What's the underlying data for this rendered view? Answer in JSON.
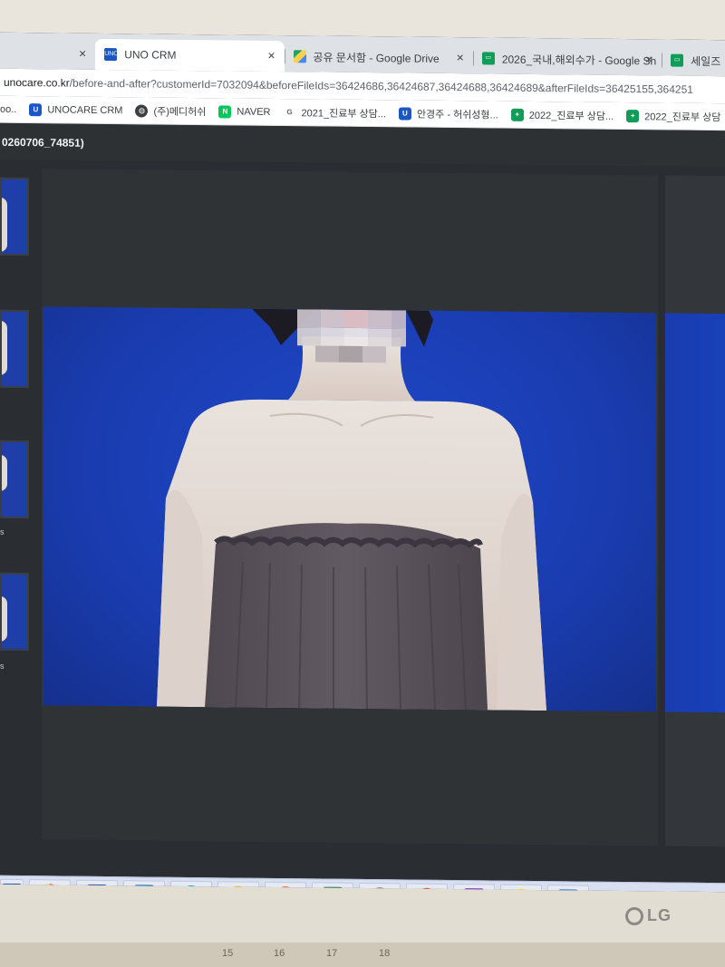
{
  "browser": {
    "tabs": [
      {
        "label": "",
        "icon": "blank-tab-icon",
        "active": false,
        "close": "×"
      },
      {
        "label": "UNO CRM",
        "icon": "uno-crm-favicon",
        "active": true,
        "close": "×"
      },
      {
        "label": "공유 문서함 - Google Drive",
        "icon": "google-drive-icon",
        "active": false,
        "close": "×"
      },
      {
        "label": "2026_국내,해외수가 - Google Sh",
        "icon": "google-sheets-icon",
        "active": false,
        "close": "×"
      },
      {
        "label": "세일즈",
        "icon": "google-sheets-icon",
        "active": false,
        "close": ""
      }
    ],
    "address": {
      "host": "unocare.co.kr",
      "path": "/before-and-after?customerId=7032094&beforeFileIds=36424686,36424687,36424688,36424689&afterFileIds=36425155,364251"
    },
    "bookmarks": [
      {
        "label": "oo..",
        "icon": ""
      },
      {
        "label": "UNOCARE CRM",
        "icon": "uno-icon"
      },
      {
        "label": "(주)메디허쉬",
        "icon": "globe-icon"
      },
      {
        "label": "NAVER",
        "icon": "naver-icon"
      },
      {
        "label": "2021_진료부 상담...",
        "icon": "google-icon"
      },
      {
        "label": "안경주 - 허쉬성형...",
        "icon": "uno-icon"
      },
      {
        "label": "2022_진료부 상담...",
        "icon": "sheets-plus-icon"
      },
      {
        "label": "2022_진료부 상담",
        "icon": "sheets-plus-icon"
      }
    ]
  },
  "page": {
    "header_text": "0260706_74851)"
  },
  "thumbnails": {
    "labels": [
      "s",
      "s"
    ]
  },
  "taskbar": {
    "apps": [
      {
        "name": "uno-app-icon",
        "glyph": "U",
        "color": "#1a56c4"
      },
      {
        "name": "chrome-icon",
        "glyph": "",
        "color": "#db4437"
      },
      {
        "name": "word-icon",
        "glyph": "W",
        "color": "#2b579a"
      },
      {
        "name": "outlook-icon",
        "glyph": "O",
        "color": "#0a64ad"
      },
      {
        "name": "internet-explorer-icon",
        "glyph": "e",
        "color": "#1ea1f1"
      },
      {
        "name": "messenger-icon",
        "glyph": "",
        "color": "#f2b600"
      },
      {
        "name": "firefox-icon",
        "glyph": "",
        "color": "#e66000"
      },
      {
        "name": "excel-icon",
        "glyph": "X",
        "color": "#217346"
      },
      {
        "name": "media-player-icon",
        "glyph": "▶",
        "color": "#7a6a5a"
      },
      {
        "name": "powerpoint-icon",
        "glyph": "P",
        "color": "#d24726"
      },
      {
        "name": "onenote-icon",
        "glyph": "N",
        "color": "#7719aa"
      },
      {
        "name": "kakaotalk-icon",
        "glyph": "TALK",
        "color": "#fae100"
      },
      {
        "name": "screen-capture-icon",
        "glyph": "",
        "color": "#3a78c8"
      }
    ]
  },
  "monitor": {
    "brand": "LG"
  },
  "desk": {
    "calendar_numbers": [
      "15",
      "16",
      "17",
      "18"
    ]
  }
}
